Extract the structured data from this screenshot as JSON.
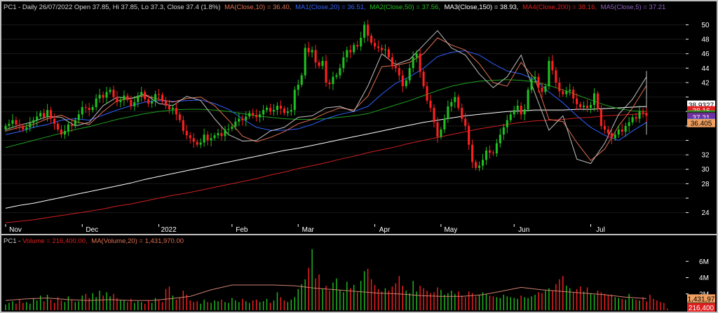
{
  "price_header": {
    "prefix": "PC1 - Daily 26/07/2022 Open 37.85, Hi 37.85, Lo 37.3, Close 37.4 (1.8%)",
    "ma10": "MA(Close,10) = 36.40,",
    "ma1": "MA1(Close,20) = 36.51,",
    "ma2": "MA2(Close,50) = 37.56,",
    "ma3": "MA3(Close,150) = 38.93,",
    "ma4": "MA4(Close,200) = 38.16,",
    "ma5": "MA5(Close,5) = 37.21"
  },
  "volume_header": {
    "prefix": "PC1 - ",
    "volume": "Volume = 216,400.00,",
    "ma": "MA(Volume,20) = 1,431,970.00"
  },
  "price_axis": {
    "ticks": [
      24,
      26,
      28,
      30,
      32,
      34,
      36,
      38,
      40,
      42,
      44,
      46,
      48,
      50
    ],
    "labels": [
      "24",
      "",
      "28",
      "30",
      "32",
      "",
      "",
      "",
      "",
      "42",
      "44",
      "46",
      "48",
      "50"
    ],
    "range": [
      22.8,
      51.3
    ]
  },
  "month_axis": {
    "labels": [
      "Nov",
      "Dec",
      "2022",
      "Feb",
      "Mar",
      "Apr",
      "May",
      "Jun",
      "Jul"
    ],
    "bar_index": [
      0,
      22,
      44,
      65,
      84,
      106,
      125,
      146,
      168
    ]
  },
  "volume_axis": {
    "ticks": [
      2000000,
      4000000,
      6000000
    ],
    "labels": [
      "2M",
      "4M",
      "6M"
    ],
    "max": 8000000
  },
  "price_badges": [
    {
      "label": "38.9327",
      "value": 38.9327,
      "bg": "#ffffff",
      "fg": "#000000"
    },
    {
      "label": "38.16",
      "value": 38.16,
      "bg": "#e02020",
      "fg": "#ffffff"
    },
    {
      "label": "37.555",
      "value": 37.555,
      "bg": "#20c020",
      "fg": "#000000"
    },
    {
      "label": "37.4",
      "value": 37.4,
      "bg": "#303030",
      "fg": "#ffffff"
    },
    {
      "label": "37.21",
      "value": 37.21,
      "bg": "#7030a0",
      "fg": "#ffffff"
    },
    {
      "label": "36.505",
      "value": 36.505,
      "bg": "#2040e0",
      "fg": "#ffffff"
    },
    {
      "label": "36.405",
      "value": 36.405,
      "bg": "#f0a060",
      "fg": "#000000"
    }
  ],
  "volume_badges": [
    {
      "label": "1,431,97",
      "value": 1431970,
      "bg": "#f0a060",
      "fg": "#000000"
    },
    {
      "label": "216,400",
      "value": 216400,
      "bg": "#e02020",
      "fg": "#ffffff"
    }
  ],
  "colors": {
    "background": "#000000",
    "up": "#20c020",
    "down": "#ff2020",
    "ma10": "#e07050",
    "ma20": "#3060ff",
    "ma50": "#20a020",
    "ma150": "#ffffff",
    "ma200": "#d02020",
    "ma5": "#c0c0c0",
    "volume_ma": "#d08070",
    "header_text": "#d0d0d0",
    "axis_text": "#ffffff"
  },
  "chart_data": {
    "type": "candlestick",
    "price": {
      "open": [
        35.5,
        36.0,
        36.3,
        36.8,
        36.2,
        36.0,
        35.5,
        35.8,
        36.4,
        36.8,
        37.3,
        37.8,
        37.2,
        38.2,
        37.0,
        36.3,
        35.5,
        34.8,
        35.3,
        36.2,
        36.0,
        36.8,
        37.6,
        38.6,
        38.5,
        38.2,
        38.6,
        39.8,
        40.3,
        39.9,
        40.7,
        41.0,
        40.0,
        39.3,
        39.6,
        40.2,
        39.6,
        38.7,
        39.3,
        40.2,
        40.7,
        39.7,
        39.1,
        39.4,
        40.4,
        40.3,
        39.4,
        38.8,
        38.3,
        38.5,
        37.6,
        36.8,
        35.3,
        34.7,
        34.3,
        33.8,
        33.4,
        33.7,
        34.8,
        34.0,
        34.3,
        34.7,
        35.0,
        34.6,
        35.5,
        35.6,
        35.9,
        36.6,
        37.0,
        36.8,
        37.3,
        37.8,
        37.5,
        37.2,
        37.6,
        38.2,
        38.5,
        38.0,
        38.2,
        38.8,
        38.4,
        37.8,
        38.0,
        38.2,
        41.0,
        41.7,
        43.0,
        46.8,
        46.2,
        46.5,
        44.8,
        44.3,
        45.0,
        42.0,
        41.8,
        42.8,
        43.0,
        44.0,
        45.5,
        46.5,
        46.2,
        47.2,
        47.0,
        48.2,
        50.0,
        48.5,
        47.5,
        47.0,
        46.8,
        46.5,
        46.6,
        45.5,
        44.3,
        44.0,
        43.0,
        41.5,
        42.3,
        44.0,
        45.5,
        46.0,
        43.5,
        41.5,
        39.5,
        38.5,
        36.5,
        34.5,
        35.5,
        37.0,
        38.7,
        39.3,
        40.0,
        38.5,
        37.0,
        36.0,
        33.4,
        31.0,
        30.2,
        30.5,
        31.3,
        32.6,
        32.3,
        32.2,
        33.6,
        34.8,
        35.8,
        36.8,
        37.6,
        38.2,
        38.8,
        37.6,
        38.3,
        41.0,
        42.5,
        42.8,
        41.3,
        40.7,
        41.5,
        45.0,
        43.7,
        42.0,
        40.8,
        40.4,
        40.8,
        41.0,
        39.8,
        39.0,
        38.6,
        38.8,
        38.5,
        38.9,
        40.5,
        38.3,
        36.0,
        35.5,
        35.0,
        34.3,
        34.8,
        35.5,
        35.2,
        36.0,
        36.5,
        37.2,
        37.0,
        38.0,
        37.8
      ],
      "close": [
        36.0,
        36.3,
        36.8,
        36.2,
        36.0,
        35.5,
        35.8,
        36.4,
        36.8,
        37.3,
        37.8,
        37.2,
        38.2,
        37.0,
        36.3,
        35.5,
        34.8,
        35.3,
        36.2,
        36.0,
        36.8,
        37.6,
        38.6,
        38.5,
        38.2,
        38.6,
        39.8,
        40.3,
        39.9,
        40.7,
        41.0,
        40.0,
        39.3,
        39.6,
        40.2,
        39.6,
        38.7,
        39.3,
        40.2,
        40.7,
        39.7,
        39.1,
        39.4,
        40.4,
        40.3,
        39.4,
        38.8,
        38.3,
        38.5,
        37.6,
        36.8,
        35.3,
        34.7,
        34.3,
        33.8,
        33.4,
        33.7,
        34.8,
        34.0,
        34.3,
        34.7,
        35.0,
        34.6,
        35.5,
        35.6,
        35.9,
        36.6,
        37.0,
        36.8,
        37.3,
        37.8,
        37.5,
        37.2,
        37.6,
        38.2,
        38.5,
        38.0,
        38.2,
        38.8,
        38.4,
        37.8,
        38.0,
        38.2,
        41.0,
        41.7,
        43.0,
        46.8,
        46.2,
        46.5,
        44.8,
        44.3,
        45.0,
        42.0,
        41.8,
        42.8,
        43.0,
        44.0,
        45.5,
        46.5,
        46.2,
        47.2,
        47.0,
        48.2,
        50.0,
        48.5,
        47.5,
        47.0,
        46.8,
        46.5,
        46.6,
        45.5,
        44.3,
        44.0,
        43.0,
        41.5,
        42.3,
        44.0,
        45.5,
        46.0,
        43.5,
        41.5,
        39.5,
        38.5,
        36.5,
        34.5,
        35.5,
        37.0,
        38.7,
        39.3,
        40.0,
        38.5,
        37.0,
        36.0,
        33.4,
        31.0,
        30.2,
        30.5,
        31.3,
        32.6,
        32.3,
        32.2,
        33.6,
        34.8,
        35.8,
        36.8,
        37.6,
        38.2,
        38.8,
        37.6,
        38.3,
        41.0,
        42.5,
        42.8,
        41.3,
        40.7,
        41.5,
        45.0,
        43.7,
        42.0,
        40.8,
        40.4,
        40.8,
        41.0,
        39.8,
        39.0,
        38.6,
        38.8,
        38.5,
        38.9,
        40.5,
        38.3,
        36.0,
        35.5,
        35.0,
        34.3,
        34.8,
        35.5,
        35.2,
        36.0,
        36.5,
        37.2,
        37.0,
        38.0,
        37.8,
        37.4
      ],
      "ma": {
        "ma10": [
          35.3,
          35.8,
          36.2,
          37.0,
          37.5,
          36.6,
          36.2,
          38.0,
          39.5,
          39.8,
          40.2,
          39.7,
          39.3,
          39.8,
          40.0,
          38.8,
          36.8,
          34.6,
          33.8,
          34.4,
          35.2,
          36.3,
          36.9,
          37.8,
          38.5,
          38.2,
          40.1,
          44.2,
          44.4,
          44.8,
          46.0,
          48.2,
          47.2,
          46.5,
          44.6,
          42.0,
          41.5,
          44.8,
          42.5,
          36.9,
          36.6,
          33.7,
          31.2,
          32.8,
          36.0,
          38.5,
          41.6,
          43.5,
          41.3,
          39.3,
          38.9,
          37.0,
          35.3,
          34.8,
          36.5,
          36.4
        ],
        "ma20": [
          34.8,
          35.2,
          35.8,
          36.2,
          36.8,
          37.0,
          36.8,
          37.5,
          38.2,
          38.8,
          39.3,
          39.5,
          39.4,
          39.5,
          39.6,
          39.1,
          38.3,
          37.0,
          35.8,
          35.4,
          35.4,
          35.6,
          36.2,
          37.0,
          37.6,
          38.0,
          38.7,
          40.4,
          41.9,
          42.8,
          44.0,
          45.6,
          46.2,
          46.4,
          45.8,
          44.6,
          43.6,
          43.2,
          42.4,
          40.7,
          39.2,
          37.4,
          35.8,
          34.7,
          34.0,
          35.3,
          36.5,
          38.0,
          38.6,
          38.5,
          38.4,
          38.0,
          37.0,
          36.3,
          36.4,
          36.5
        ],
        "ma50": [
          33.0,
          33.5,
          34.0,
          34.5,
          35.0,
          35.5,
          35.9,
          36.4,
          36.9,
          37.3,
          37.7,
          38.0,
          38.2,
          38.3,
          38.3,
          38.2,
          38.0,
          37.7,
          37.4,
          37.2,
          37.0,
          36.9,
          36.9,
          37.0,
          37.2,
          37.4,
          37.7,
          38.3,
          38.9,
          39.5,
          40.2,
          40.9,
          41.5,
          41.9,
          42.2,
          42.3,
          42.4,
          42.3,
          42.1,
          41.6,
          41.0,
          40.3,
          39.6,
          38.9,
          38.4,
          38.1,
          38.0,
          38.1,
          38.2,
          38.3,
          38.4,
          38.3,
          37.9,
          37.7,
          37.6,
          37.56
        ],
        "ma150": [
          24.6,
          25.0,
          25.3,
          25.7,
          26.1,
          26.5,
          26.9,
          27.3,
          27.7,
          28.1,
          28.6,
          29.0,
          29.4,
          29.8,
          30.2,
          30.6,
          31.0,
          31.4,
          31.8,
          32.2,
          32.6,
          32.9,
          33.3,
          33.7,
          34.1,
          34.5,
          34.9,
          35.3,
          35.7,
          36.1,
          36.5,
          36.8,
          37.1,
          37.4,
          37.6,
          37.8,
          38.0,
          38.1,
          38.2,
          38.2,
          38.2,
          38.3,
          38.3,
          38.4,
          38.5,
          38.6,
          38.7,
          38.8,
          38.8,
          38.9,
          38.9,
          38.9,
          38.9,
          38.9,
          38.9,
          38.93
        ],
        "ma200": [
          22.6,
          22.8,
          23.0,
          23.3,
          23.6,
          23.9,
          24.2,
          24.5,
          24.9,
          25.2,
          25.6,
          26.0,
          26.4,
          26.7,
          27.1,
          27.5,
          27.9,
          28.3,
          28.7,
          29.2,
          29.6,
          30.1,
          30.5,
          30.9,
          31.4,
          31.8,
          32.3,
          32.7,
          33.1,
          33.6,
          34.0,
          34.4,
          34.8,
          35.2,
          35.6,
          35.9,
          36.2,
          36.5,
          36.7,
          36.8,
          36.9,
          37.1,
          37.2,
          37.4,
          37.5,
          37.6,
          37.7,
          37.8,
          37.9,
          38.0,
          38.0,
          38.1,
          38.1,
          38.1,
          38.2,
          38.16
        ],
        "ma5": [
          35.5,
          36.1,
          36.6,
          37.3,
          37.2,
          36.0,
          36.5,
          38.8,
          40.0,
          39.8,
          40.4,
          39.1,
          38.8,
          40.1,
          39.5,
          37.0,
          34.8,
          33.9,
          34.0,
          35.3,
          35.8,
          37.2,
          37.4,
          38.5,
          38.7,
          38.0,
          41.5,
          46.0,
          44.5,
          45.2,
          47.2,
          49.2,
          46.8,
          45.8,
          43.2,
          41.3,
          42.8,
          45.8,
          40.5,
          35.4,
          37.4,
          31.4,
          30.8,
          33.6,
          37.6,
          39.7,
          42.8,
          43.6,
          40.5,
          38.9,
          39.3,
          35.0,
          34.8,
          35.3,
          37.3,
          37.21
        ]
      }
    },
    "volume": {
      "values": [
        0.7,
        0.9,
        1.1,
        0.8,
        1.3,
        0.9,
        1.0,
        0.8,
        1.5,
        1.2,
        1.8,
        1.1,
        1.9,
        1.3,
        0.9,
        1.6,
        1.2,
        1.0,
        1.7,
        1.3,
        1.0,
        1.1,
        1.8,
        2.0,
        1.5,
        2.1,
        1.6,
        2.4,
        1.8,
        2.2,
        1.7,
        2.0,
        1.5,
        1.3,
        1.2,
        1.0,
        1.4,
        0.9,
        1.1,
        1.0,
        0.8,
        1.2,
        0.9,
        1.5,
        1.3,
        1.0,
        2.6,
        2.9,
        1.8,
        1.3,
        1.6,
        2.4,
        1.9,
        1.2,
        1.0,
        1.1,
        0.8,
        1.3,
        1.0,
        0.9,
        1.2,
        1.1,
        1.3,
        1.0,
        0.9,
        1.5,
        1.2,
        1.0,
        1.4,
        1.1,
        0.9,
        1.2,
        1.3,
        1.0,
        1.1,
        1.4,
        0.9,
        1.2,
        2.2,
        1.6,
        1.2,
        1.0,
        1.3,
        1.6,
        2.6,
        3.2,
        3.8,
        5.2,
        7.5,
        3.9,
        4.4,
        2.6,
        3.0,
        2.4,
        3.4,
        3.9,
        2.5,
        2.2,
        3.5,
        2.7,
        3.1,
        2.2,
        3.6,
        4.8,
        5.1,
        3.8,
        3.1,
        2.6,
        2.3,
        2.7,
        2.4,
        2.9,
        3.3,
        4.2,
        3.0,
        2.4,
        2.1,
        3.6,
        2.3,
        3.0,
        2.7,
        2.4,
        2.1,
        2.2,
        2.8,
        2.5,
        1.9,
        2.1,
        2.4,
        2.0,
        2.3,
        1.8,
        1.6,
        2.3,
        2.1,
        1.7,
        1.9,
        2.2,
        2.0,
        1.8,
        1.7,
        1.6,
        1.5,
        1.9,
        1.7,
        1.6,
        1.5,
        1.4,
        1.8,
        1.6,
        1.5,
        1.7,
        1.9,
        2.2,
        2.1,
        2.4,
        2.7,
        2.4,
        3.2,
        3.8,
        4.2,
        3.0,
        2.7,
        2.2,
        2.6,
        2.9,
        2.3,
        2.8,
        2.1,
        1.9,
        2.4,
        2.2,
        2.0,
        1.8,
        1.9,
        1.6,
        1.5,
        1.4,
        1.3,
        2.0,
        1.4,
        1.3,
        1.2,
        1.6,
        1.1,
        1.9,
        1.4,
        1.2,
        1.0,
        0.9,
        0.216
      ],
      "unit": "millions",
      "ma20": [
        1.2,
        1.4,
        1.5,
        1.3,
        1.2,
        1.3,
        1.2,
        1.2,
        1.4,
        1.7,
        2.5,
        3.1,
        3.1,
        3.1,
        3.0,
        2.7,
        2.5,
        2.3,
        2.1,
        2.0,
        1.8,
        1.7,
        1.7,
        1.9,
        2.3,
        2.8,
        2.5,
        2.3,
        2.1,
        1.9,
        1.6,
        1.43
      ]
    }
  }
}
